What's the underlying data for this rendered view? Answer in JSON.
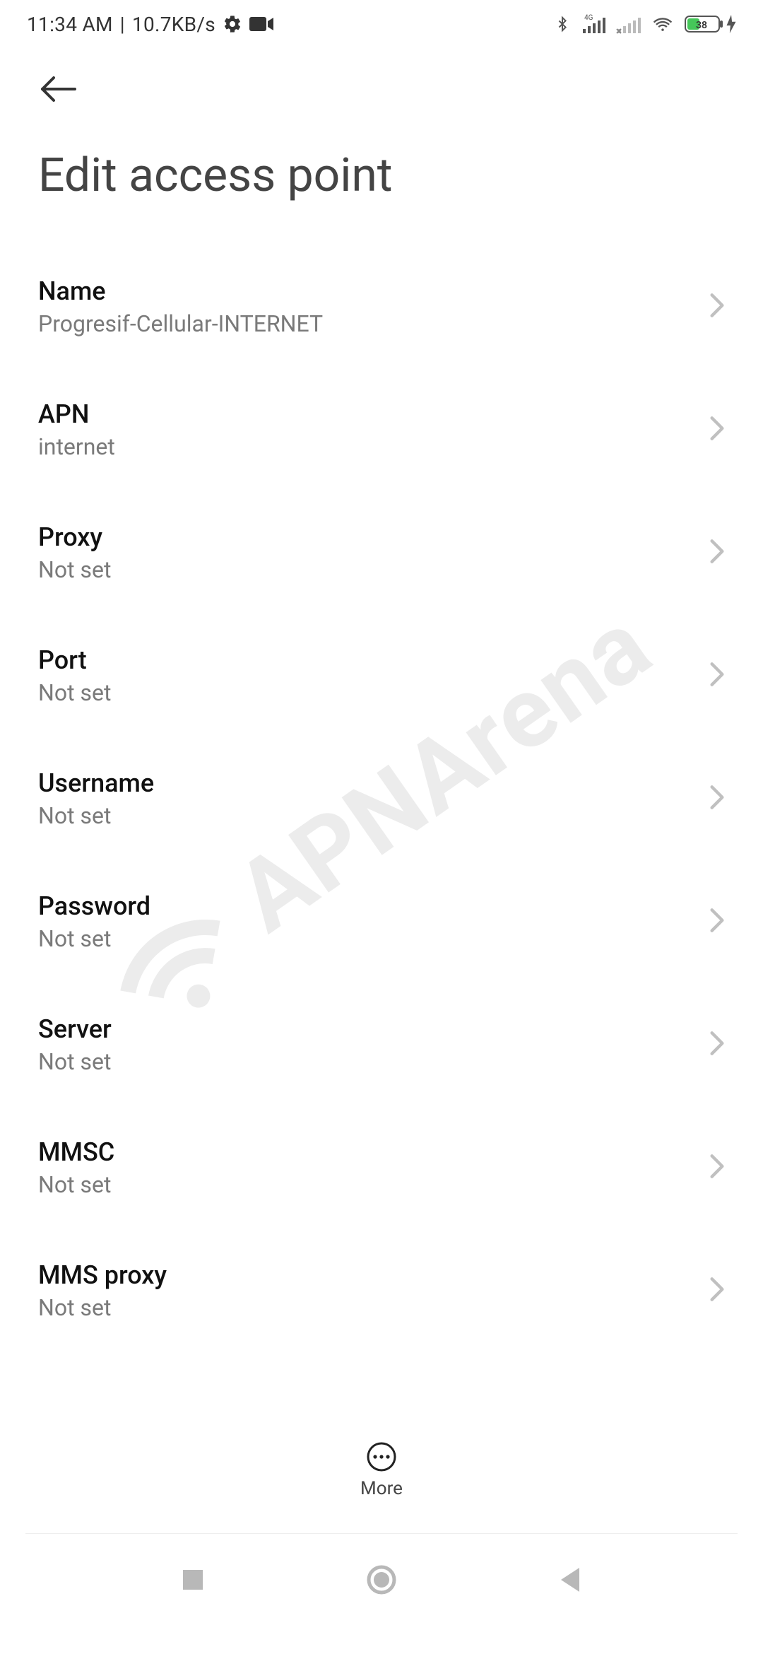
{
  "status": {
    "time": "11:34 AM",
    "sep": " | ",
    "net_speed": "10.7KB/s",
    "battery_pct": "38"
  },
  "header": {
    "title": "Edit access point"
  },
  "items": [
    {
      "label": "Name",
      "value": "Progresif-Cellular-INTERNET"
    },
    {
      "label": "APN",
      "value": "internet"
    },
    {
      "label": "Proxy",
      "value": "Not set"
    },
    {
      "label": "Port",
      "value": "Not set"
    },
    {
      "label": "Username",
      "value": "Not set"
    },
    {
      "label": "Password",
      "value": "Not set"
    },
    {
      "label": "Server",
      "value": "Not set"
    },
    {
      "label": "MMSC",
      "value": "Not set"
    },
    {
      "label": "MMS proxy",
      "value": "Not set"
    }
  ],
  "more": {
    "label": "More"
  },
  "watermark": {
    "text": "APNArena"
  }
}
